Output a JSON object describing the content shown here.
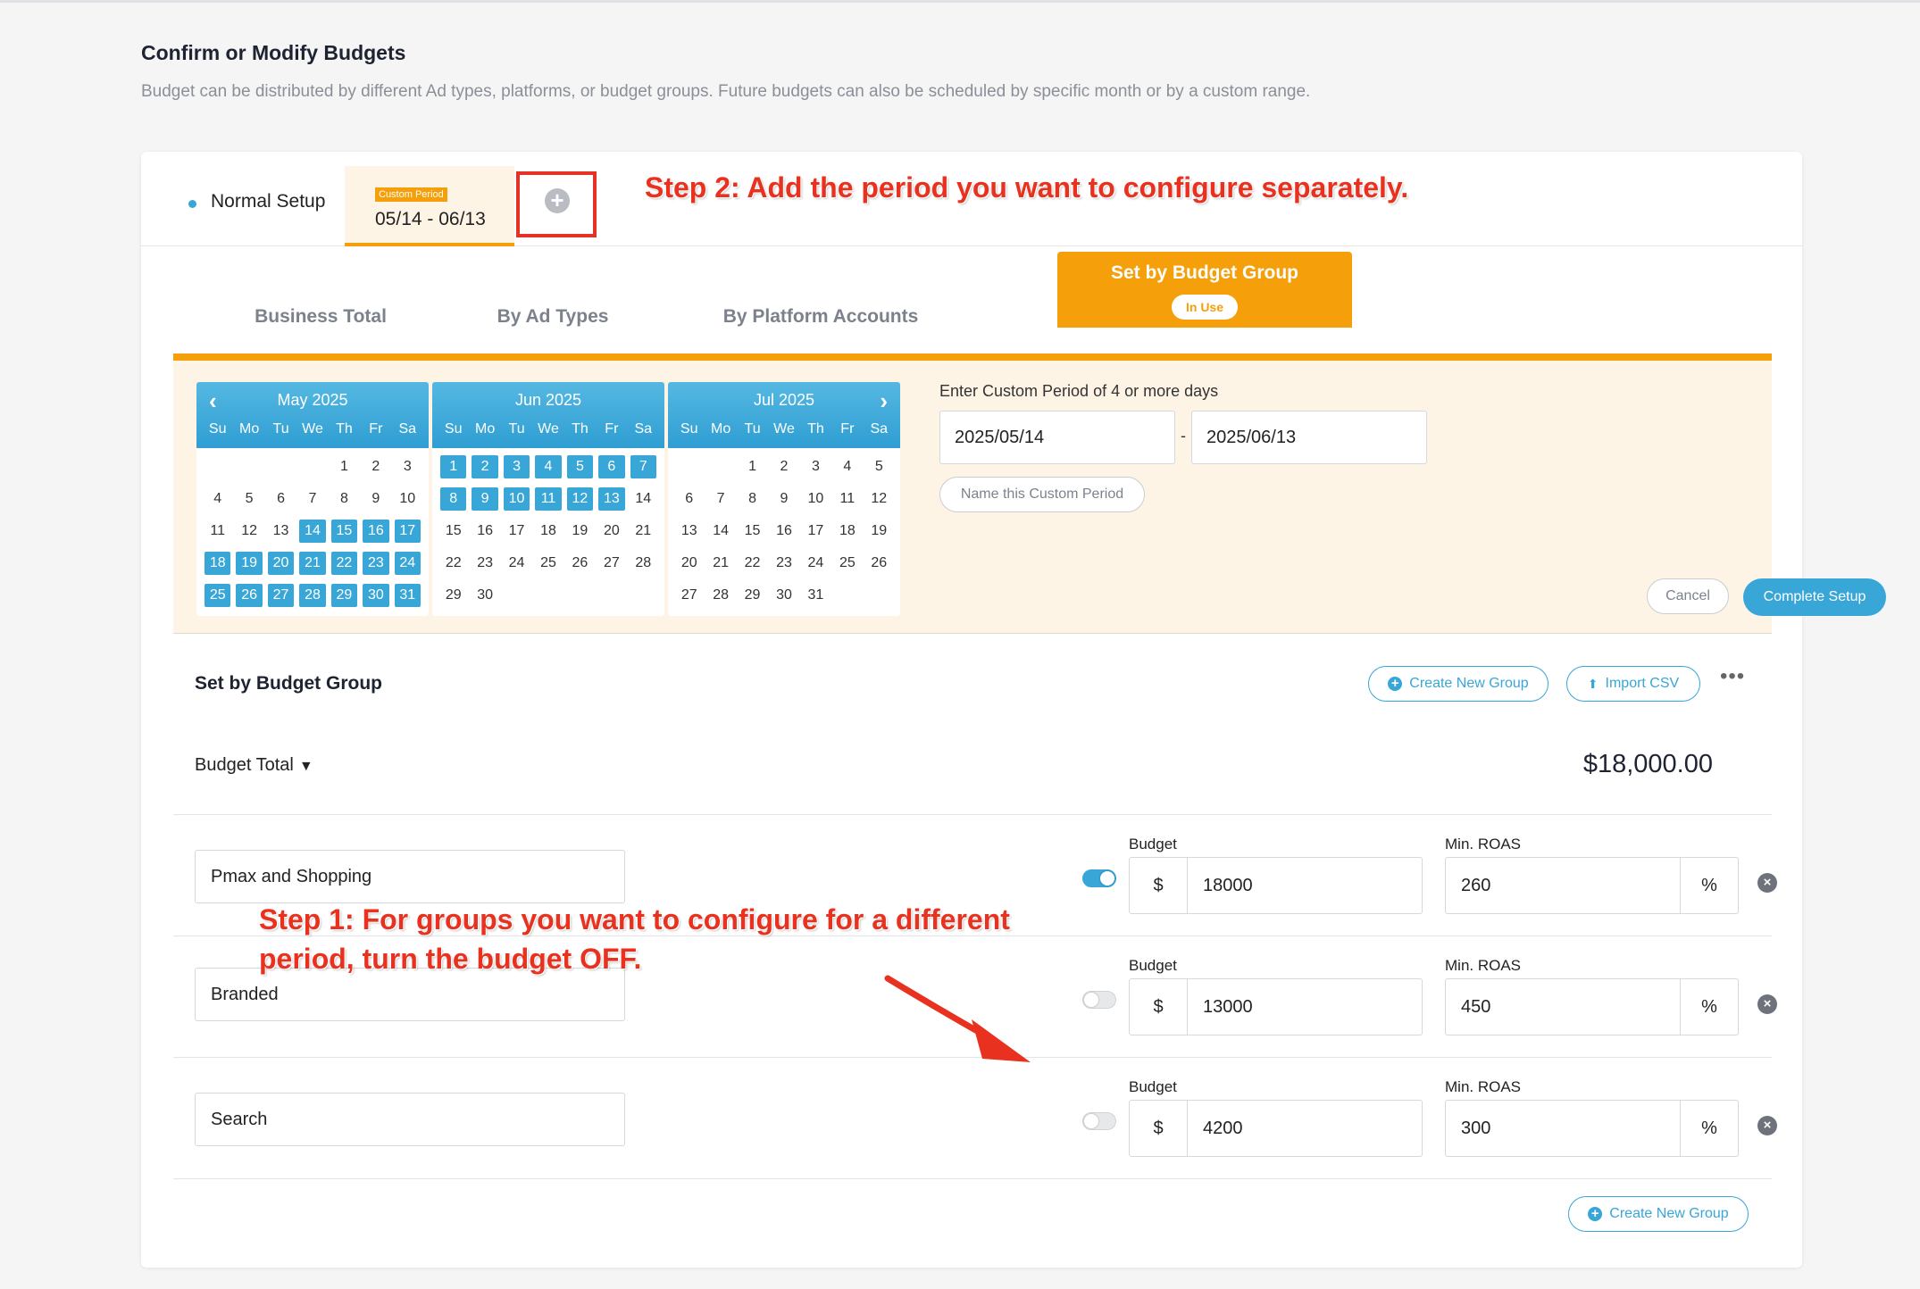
{
  "page": {
    "title": "Confirm or Modify Budgets",
    "subtitle": "Budget can be distributed by different Ad types, platforms, or budget groups. Future budgets can also be scheduled by specific month or by a custom range."
  },
  "period_bar": {
    "normal_setup": "Normal Setup",
    "custom_badge": "Custom Period",
    "custom_range": "05/14 - 06/13",
    "add_icon": "plus-circle-icon"
  },
  "annotations": {
    "step2": "Step 2: Add the period you want to configure separately.",
    "step1": "Step 1:  For groups you want to configure for a different period, turn the budget OFF."
  },
  "tabs": {
    "business_total": "Business Total",
    "by_ad_types": "By Ad Types",
    "by_platform_accounts": "By Platform Accounts",
    "set_by_budget_group": "Set by Budget Group",
    "in_use": "In Use"
  },
  "calendar": {
    "dow": [
      "Su",
      "Mo",
      "Tu",
      "We",
      "Th",
      "Fr",
      "Sa"
    ],
    "months": [
      {
        "title": "May 2025",
        "lead_blanks": 4,
        "days": 31,
        "selected_from": 14,
        "selected_to": 31
      },
      {
        "title": "Jun 2025",
        "lead_blanks": 0,
        "days": 30,
        "selected_from": 1,
        "selected_to": 13
      },
      {
        "title": "Jul 2025",
        "lead_blanks": 2,
        "days": 31,
        "selected_from": 0,
        "selected_to": 0
      }
    ],
    "prev_icon": "chevron-left-icon",
    "next_icon": "chevron-right-icon"
  },
  "custom_period": {
    "label": "Enter Custom Period of 4 or more days",
    "start": "2025/05/14",
    "end": "2025/06/13",
    "separator": "-",
    "name_button": "Name this Custom Period",
    "cancel": "Cancel",
    "complete": "Complete Setup"
  },
  "budget_group": {
    "title": "Set by Budget Group",
    "create_new_group": "Create New Group",
    "import_csv": "Import CSV",
    "more": "•••",
    "budget_total_label": "Budget Total",
    "budget_total_value": "$18,000.00",
    "budget_label": "Budget",
    "roas_label": "Min. ROAS",
    "currency": "$",
    "percent": "%",
    "groups": [
      {
        "name": "Pmax and Shopping",
        "enabled": true,
        "budget": "18000",
        "roas": "260"
      },
      {
        "name": "Branded",
        "enabled": false,
        "budget": "13000",
        "roas": "450"
      },
      {
        "name": "Search",
        "enabled": false,
        "budget": "4200",
        "roas": "300"
      }
    ],
    "bottom_create": "Create New Group"
  },
  "colors": {
    "accent_blue": "#38a6d6",
    "accent_orange": "#f5a00b",
    "annotation_red": "#e8321f"
  }
}
